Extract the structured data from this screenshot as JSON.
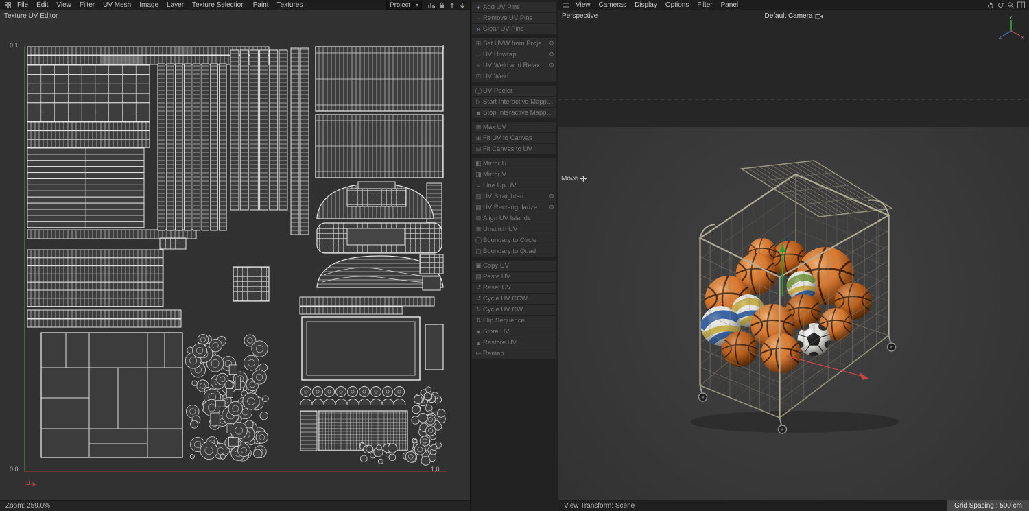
{
  "colors": {
    "accent_axis_green": "#3c6b3c",
    "accent_axis_red": "#6e3434",
    "ball_orange": "#d4722a",
    "wireframe_white": "#e4e4e4"
  },
  "menubar": {
    "left_items": [
      "File",
      "Edit",
      "View",
      "Filter",
      "UV Mesh",
      "Image",
      "Layer",
      "Texture Selection",
      "Paint",
      "Textures"
    ],
    "project_label": "Project",
    "right_items": [
      "View",
      "Cameras",
      "Display",
      "Options",
      "Filter",
      "Panel"
    ]
  },
  "uv_editor": {
    "title": "Texture UV Editor",
    "zoom_status": "Zoom: 259.0%",
    "coords": {
      "top_left": "0,1",
      "top_right": "1",
      "bottom_left": "0,0",
      "bottom_right": "1,0"
    },
    "u_axis": "U"
  },
  "tool_panel": {
    "groups": [
      {
        "items": [
          {
            "label": "Add UV Pins",
            "icon": "pin-add",
            "gear": false
          },
          {
            "label": "Remove UV Pins",
            "icon": "pin-remove",
            "gear": false
          },
          {
            "label": "Clear UV Pins",
            "icon": "pin-clear",
            "gear": false
          }
        ]
      },
      {
        "items": [
          {
            "label": "Set UVW from Projection",
            "icon": "projection",
            "gear": true
          },
          {
            "label": "UV Unwrap",
            "icon": "unwrap",
            "gear": true
          },
          {
            "label": "UV Weld and Relax",
            "icon": "weld-relax",
            "gear": true
          },
          {
            "label": "UV Weld",
            "icon": "weld",
            "gear": false
          }
        ]
      },
      {
        "items": [
          {
            "label": "UV Peeler",
            "icon": "peeler",
            "gear": false
          },
          {
            "label": "Start Interactive Mapping",
            "icon": "start-mapping",
            "gear": false
          },
          {
            "label": "Stop Interactive Mapping",
            "icon": "stop-mapping",
            "gear": false
          }
        ]
      },
      {
        "items": [
          {
            "label": "Max UV",
            "icon": "max-uv",
            "gear": false
          },
          {
            "label": "Fit UV to Canvas",
            "icon": "fit-uv-canvas",
            "gear": false
          },
          {
            "label": "Fit Canvas to UV",
            "icon": "fit-canvas-uv",
            "gear": false
          }
        ]
      },
      {
        "items": [
          {
            "label": "Mirror U",
            "icon": "mirror-u",
            "gear": false
          },
          {
            "label": "Mirror V",
            "icon": "mirror-v",
            "gear": false
          },
          {
            "label": "Line Up UV",
            "icon": "line-up",
            "gear": false
          },
          {
            "label": "UV Straighten",
            "icon": "straighten",
            "gear": true
          },
          {
            "label": "UV Rectangularize",
            "icon": "rectangularize",
            "gear": true
          },
          {
            "label": "Align UV Islands",
            "icon": "align-islands",
            "gear": false
          },
          {
            "label": "Unstitch UV",
            "icon": "unstitch",
            "gear": false
          },
          {
            "label": "Boundary to Circle",
            "icon": "boundary-circle",
            "gear": false
          },
          {
            "label": "Boundary to Quad",
            "icon": "boundary-quad",
            "gear": false
          }
        ]
      },
      {
        "items": [
          {
            "label": "Copy UV",
            "icon": "copy",
            "gear": false
          },
          {
            "label": "Paste UV",
            "icon": "paste",
            "gear": false
          },
          {
            "label": "Reset UV",
            "icon": "reset",
            "gear": false
          },
          {
            "label": "Cycle UV CCW",
            "icon": "cycle-ccw",
            "gear": false
          },
          {
            "label": "Cycle UV CW",
            "icon": "cycle-cw",
            "gear": false
          },
          {
            "label": "Flip Sequence",
            "icon": "flip-sequence",
            "gear": false
          },
          {
            "label": "Store UV",
            "icon": "store",
            "gear": false
          },
          {
            "label": "Restore UV",
            "icon": "restore",
            "gear": false
          },
          {
            "label": "Remap...",
            "icon": "remap",
            "gear": false
          }
        ]
      }
    ]
  },
  "viewport": {
    "view_label": "Perspective",
    "camera_label": "Default Camera",
    "tool_hint": "Move",
    "status_left": "View Transform: Scene",
    "status_right": "Grid Spacing : 500 cm",
    "gizmo": {
      "x": "X",
      "y": "Y",
      "z": "Z"
    }
  }
}
